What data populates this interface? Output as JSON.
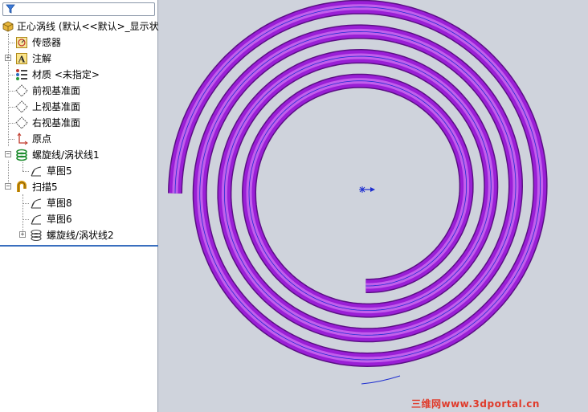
{
  "feature_tree": {
    "root_label": "正心涡线  (默认<<默认>_显示状",
    "items": [
      {
        "label": "传感器",
        "icon": "sensor-icon"
      },
      {
        "label": "注解",
        "icon": "annotation-icon"
      },
      {
        "label": "材质 <未指定>",
        "icon": "material-icon"
      },
      {
        "label": "前视基准面",
        "icon": "plane-icon"
      },
      {
        "label": "上视基准面",
        "icon": "plane-icon"
      },
      {
        "label": "右视基准面",
        "icon": "plane-icon"
      },
      {
        "label": "原点",
        "icon": "origin-icon"
      },
      {
        "label": "螺旋线/涡状线1",
        "icon": "helix-icon"
      },
      {
        "label": "草图5",
        "icon": "sketch-icon"
      },
      {
        "label": "扫描5",
        "icon": "sweep-icon"
      },
      {
        "label": "草图8",
        "icon": "sketch-icon"
      },
      {
        "label": "草图6",
        "icon": "sketch-icon"
      },
      {
        "label": "螺旋线/涡状线2",
        "icon": "helix-icon"
      }
    ]
  },
  "viewport": {
    "tube_color": "#9a1fd6",
    "tube_highlight": "#d27af5",
    "tube_shadow": "#5b0f84",
    "curve_color": "#1f2fd0",
    "background": "#cfd3dc"
  },
  "watermark": "三维网www.3dportal.cn"
}
